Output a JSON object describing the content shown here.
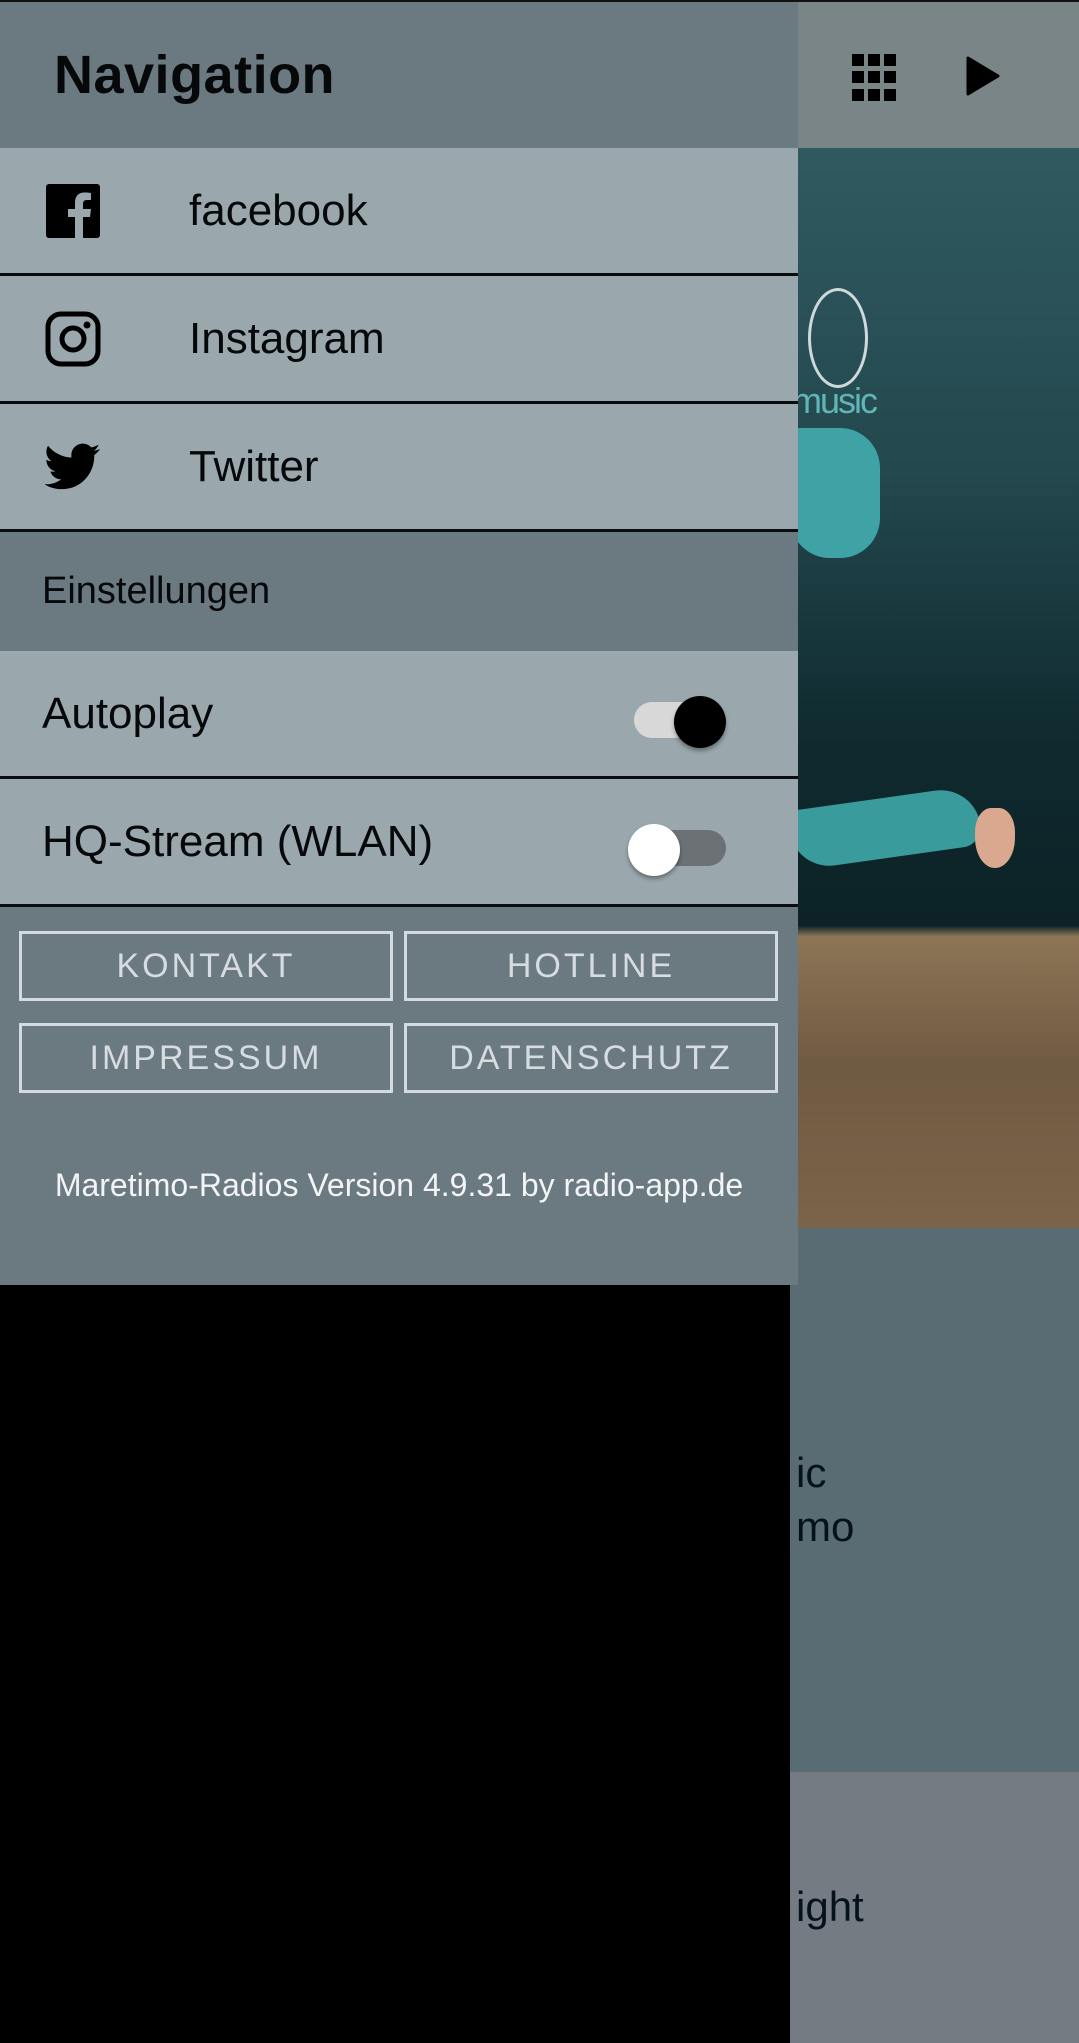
{
  "drawer": {
    "title": "Navigation",
    "social_links": [
      {
        "icon": "facebook-icon",
        "label": "facebook"
      },
      {
        "icon": "instagram-icon",
        "label": "Instagram"
      },
      {
        "icon": "twitter-icon",
        "label": "Twitter"
      }
    ],
    "settings_header": "Einstellungen",
    "settings": [
      {
        "label": "Autoplay",
        "enabled": true
      },
      {
        "label": "HQ-Stream (WLAN)",
        "enabled": false
      }
    ],
    "buttons": [
      "KONTAKT",
      "HOTLINE",
      "IMPRESSUM",
      "DATENSCHUTZ"
    ],
    "version_text": "Maretimo-Radios Version 4.9.31 by radio-app.de"
  },
  "background": {
    "topbar_icons": [
      "grid-icon",
      "play-icon"
    ],
    "cover_logo_text": "music",
    "card1_text_line1": "ic",
    "card1_text_line2": "mo",
    "card2_text": "ight"
  },
  "colors": {
    "drawer_dark": "#6b7a81",
    "drawer_light": "#9aa8ae",
    "divider": "#0a0d0f",
    "button_border": "#d3dbde"
  }
}
